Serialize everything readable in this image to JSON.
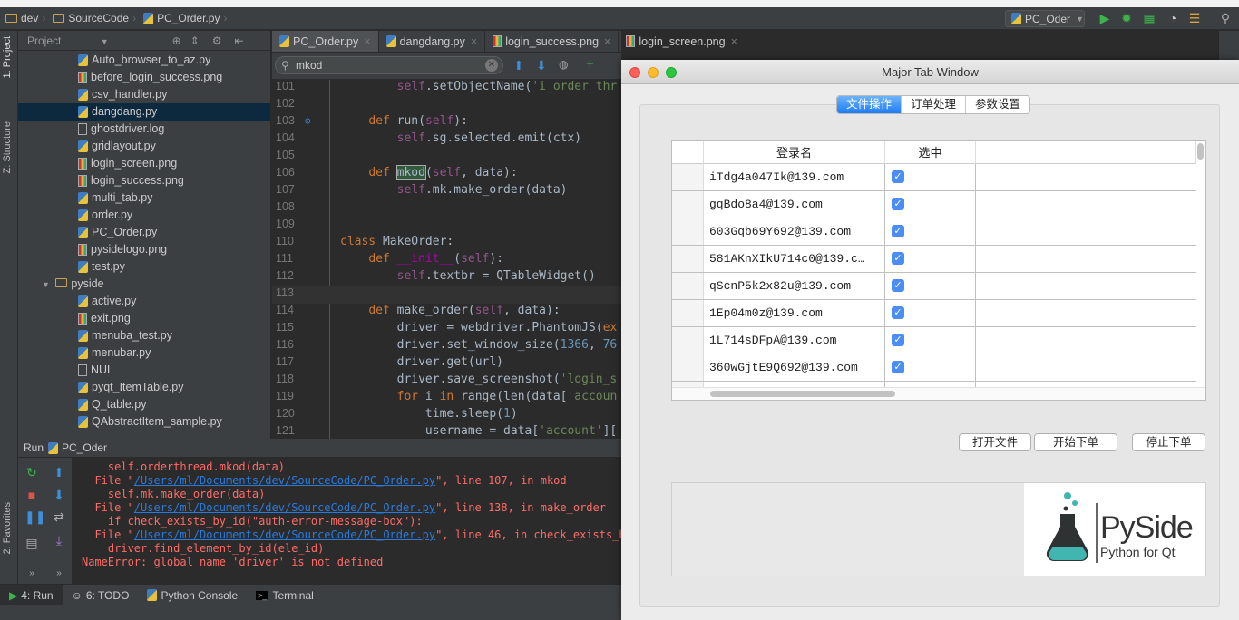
{
  "breadcrumb": [
    "dev",
    "SourceCode",
    "PC_Order.py"
  ],
  "toolbar": {
    "run_config": "PC_Oder"
  },
  "left_stripe": {
    "project": "1: Project",
    "structure": "Z: Structure",
    "favorites": "2: Favorites"
  },
  "project_panel": {
    "title": "Project",
    "items": [
      {
        "label": "Auto_browser_to_az.py",
        "type": "py"
      },
      {
        "label": "before_login_success.png",
        "type": "png"
      },
      {
        "label": "csv_handler.py",
        "type": "py"
      },
      {
        "label": "dangdang.py",
        "type": "py",
        "selected": true
      },
      {
        "label": "ghostdriver.log",
        "type": "file"
      },
      {
        "label": "gridlayout.py",
        "type": "py"
      },
      {
        "label": "login_screen.png",
        "type": "png"
      },
      {
        "label": "login_success.png",
        "type": "png"
      },
      {
        "label": "multi_tab.py",
        "type": "py"
      },
      {
        "label": "order.py",
        "type": "py"
      },
      {
        "label": "PC_Order.py",
        "type": "py"
      },
      {
        "label": "pysidelogo.png",
        "type": "png"
      },
      {
        "label": "test.py",
        "type": "py"
      },
      {
        "label": "pyside",
        "type": "folder"
      },
      {
        "label": "active.py",
        "type": "py"
      },
      {
        "label": "exit.png",
        "type": "png"
      },
      {
        "label": "menuba_test.py",
        "type": "py"
      },
      {
        "label": "menubar.py",
        "type": "py"
      },
      {
        "label": "NUL",
        "type": "file"
      },
      {
        "label": "pyqt_ItemTable.py",
        "type": "py"
      },
      {
        "label": "Q_table.py",
        "type": "py"
      },
      {
        "label": "QAbstractItem_sample.py",
        "type": "py"
      }
    ]
  },
  "editor": {
    "tabs": [
      {
        "label": "PC_Order.py",
        "type": "py",
        "active": true
      },
      {
        "label": "dangdang.py",
        "type": "py"
      },
      {
        "label": "login_success.png",
        "type": "png"
      },
      {
        "label": "login_screen.png",
        "type": "png"
      }
    ],
    "search": "mkod",
    "lines": [
      {
        "n": "101",
        "html": "        <span class='sf'>self</span>.setObjectName(<span class='st'>'i_order_thr</span>"
      },
      {
        "n": "102",
        "html": ""
      },
      {
        "n": "103",
        "html": "    <span class='kw'>def</span> run(<span class='sf'>self</span>):"
      },
      {
        "n": "104",
        "html": "        <span class='sf'>self</span>.sg.selected.emit(ctx)"
      },
      {
        "n": "105",
        "html": ""
      },
      {
        "n": "106",
        "html": "    <span class='kw'>def</span> <span class='hl'>mkod</span>(<span class='sf'>self</span>, data):"
      },
      {
        "n": "107",
        "html": "        <span class='sf'>self</span>.mk.make_order(data)"
      },
      {
        "n": "108",
        "html": ""
      },
      {
        "n": "109",
        "html": ""
      },
      {
        "n": "110",
        "html": "<span class='kw'>class</span> MakeOrder:"
      },
      {
        "n": "111",
        "html": "    <span class='kw'>def</span> <span class='mg'>__init__</span>(<span class='sf'>self</span>):"
      },
      {
        "n": "112",
        "html": "        <span class='sf'>self</span>.textbr = QTableWidget()"
      },
      {
        "n": "113",
        "html": ""
      },
      {
        "n": "114",
        "html": "    <span class='kw'>def</span> make_order(<span class='sf'>self</span>, data):"
      },
      {
        "n": "115",
        "html": "        driver = webdriver.PhantomJS(<span class='kw'>ex</span>"
      },
      {
        "n": "116",
        "html": "        driver.set_window_size(<span class='nm'>1366</span>, <span class='nm'>76</span>"
      },
      {
        "n": "117",
        "html": "        driver.get(url)"
      },
      {
        "n": "118",
        "html": "        driver.save_screenshot(<span class='st'>'login_s</span>"
      },
      {
        "n": "119",
        "html": "        <span class='kw'>for</span> i <span class='kw'>in</span> range(len(data[<span class='st'>'accoun</span>"
      },
      {
        "n": "120",
        "html": "            time.sleep(<span class='nm'>1</span>)"
      },
      {
        "n": "121",
        "html": "            username = data[<span class='st'>'account'</span>]["
      }
    ]
  },
  "run_panel": {
    "label": "Run",
    "config": "PC_Oder",
    "output": [
      "    self.orderthread.mkod(data)",
      "  File \"<a>/Users/ml/Documents/dev/SourceCode/PC_Order.py</a>\", line 107, in mkod",
      "    self.mk.make_order(data)",
      "  File \"<a>/Users/ml/Documents/dev/SourceCode/PC_Order.py</a>\", line 138, in make_order",
      "    if check_exists_by_id(\"auth-error-message-box\"):",
      "  File \"<a>/Users/ml/Documents/dev/SourceCode/PC_Order.py</a>\", line 46, in check_exists_by_",
      "    driver.find_element_by_id(ele_id)",
      "NameError: global name 'driver' is not defined"
    ]
  },
  "bottom_tabs": [
    "4: Run",
    "6: TODO",
    "Python Console",
    "Terminal"
  ],
  "qt_window": {
    "title": "Major Tab Window",
    "tabs": [
      "文件操作",
      "订单处理",
      "参数设置"
    ],
    "table": {
      "headers": [
        "登录名",
        "选中"
      ],
      "rows": [
        {
          "login": "iTdg4a047Ik@139.com",
          "checked": true
        },
        {
          "login": "gqBdo8a4@139.com",
          "checked": true
        },
        {
          "login": "603Gqb69Y692@139.com",
          "checked": true
        },
        {
          "login": "581AKnXIkU714c0@139.c…",
          "checked": true
        },
        {
          "login": "qScnP5k2x82u@139.com",
          "checked": true
        },
        {
          "login": "1Ep04m0z@139.com",
          "checked": true
        },
        {
          "login": "1L714sDFpA@139.com",
          "checked": true
        },
        {
          "login": "360wGjtE9Q692@139.com",
          "checked": true
        }
      ]
    },
    "buttons": {
      "open": "打开文件",
      "start": "开始下单",
      "stop": "停止下单"
    },
    "logo": {
      "brand": "PySide",
      "tagline": "Python for Qt"
    }
  }
}
